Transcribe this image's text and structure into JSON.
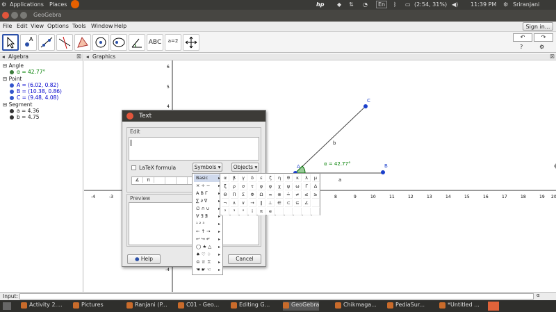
{
  "topbar": {
    "apps": "Applications",
    "places": "Places",
    "battery": "(2:54, 31%)",
    "clock": "11:39 PM",
    "user": "Sriranjani",
    "lang": "En"
  },
  "window": {
    "title": "GeoGebra",
    "signin": "Sign in..."
  },
  "menu": [
    "File",
    "Edit",
    "View",
    "Options",
    "Tools",
    "Window",
    "Help"
  ],
  "tools": [
    "move-tool",
    "point-tool",
    "line-tool",
    "perpendicular-tool",
    "polygon-tool",
    "circle-tool",
    "conic-tool",
    "angle-tool",
    "text-tool",
    "slider-tool",
    "move-view-tool"
  ],
  "tool_text": {
    "abc": "ABC",
    "slider": "a=2"
  },
  "algebra": {
    "title": "Algebra",
    "groups": [
      {
        "name": "Angle",
        "items": [
          {
            "text": "α = 42.77°",
            "color": "#007f00"
          }
        ]
      },
      {
        "name": "Point",
        "items": [
          {
            "text": "A = (6.02, 0.82)",
            "color": "#0000cc"
          },
          {
            "text": "B = (10.38, 0.86)",
            "color": "#0000cc"
          },
          {
            "text": "C = (9.48, 4.08)",
            "color": "#0000cc"
          }
        ]
      },
      {
        "name": "Segment",
        "items": [
          {
            "text": "a = 4.36",
            "color": "#111"
          },
          {
            "text": "b = 4.75",
            "color": "#111"
          }
        ]
      }
    ]
  },
  "graphics": {
    "title": "Graphics",
    "x_ticks": [
      "-4",
      "-3",
      "8",
      "9",
      "10",
      "11",
      "12",
      "13",
      "14",
      "15",
      "16",
      "17",
      "18",
      "19",
      "20"
    ],
    "y_ticks": [
      "6",
      "5",
      "4",
      "-4"
    ],
    "labels": {
      "A": "A",
      "B": "B",
      "C": "C",
      "seg_a": "a",
      "seg_b": "b",
      "angle": "α = 42.77°"
    }
  },
  "dialog": {
    "title": "Text",
    "edit": "Edit",
    "latex": "LaTeX formula",
    "symbols": "Symbols",
    "objects": "Objects",
    "preview": "Preview",
    "help": "Help",
    "cancel": "Cancel",
    "quick": [
      "∡",
      "π",
      "",
      "",
      "",
      "",
      ""
    ]
  },
  "symbols_menu": [
    "Basic",
    "× ÷ −",
    "Α Β Γ",
    "∑ ∂ ∇",
    "∅ ∩ ∪",
    "∀ ∃ ∄",
    "¹ ² ³",
    "← ↑ →",
    "↩ ↪ ↵",
    "◯ ★ △",
    "♠ ♡ ♢",
    "♔ ♕ ♖",
    "☚ ☛ ☜"
  ],
  "symbol_grid": [
    [
      "α",
      "β",
      "γ",
      "δ",
      "ε",
      "ζ",
      "η",
      "θ",
      "κ",
      "λ",
      "μ"
    ],
    [
      "ξ",
      "ρ",
      "σ",
      "τ",
      "φ",
      "φ",
      "χ",
      "ψ",
      "ω",
      "Γ",
      "Δ"
    ],
    [
      "Θ",
      "Π",
      "Σ",
      "Φ",
      "Ω",
      "∞",
      "⊗",
      "≟",
      "≠",
      "≤",
      "≥"
    ],
    [
      "¬",
      "∧",
      "∨",
      "→",
      "∥",
      "⊥",
      "∈",
      "⊂",
      "⊆",
      "∠",
      ""
    ],
    [
      "²",
      "³",
      "°",
      "i",
      "π",
      "e",
      "",
      "",
      "",
      "",
      ""
    ]
  ],
  "input": {
    "label": "Input:"
  },
  "taskbar": [
    "Activity 2....",
    "Pictures",
    "Ranjani (P...",
    "C01 - Geo...",
    "Editing G...",
    "GeoGebra",
    "Chikmaga...",
    "PediaSur...",
    "*Untitled ..."
  ]
}
